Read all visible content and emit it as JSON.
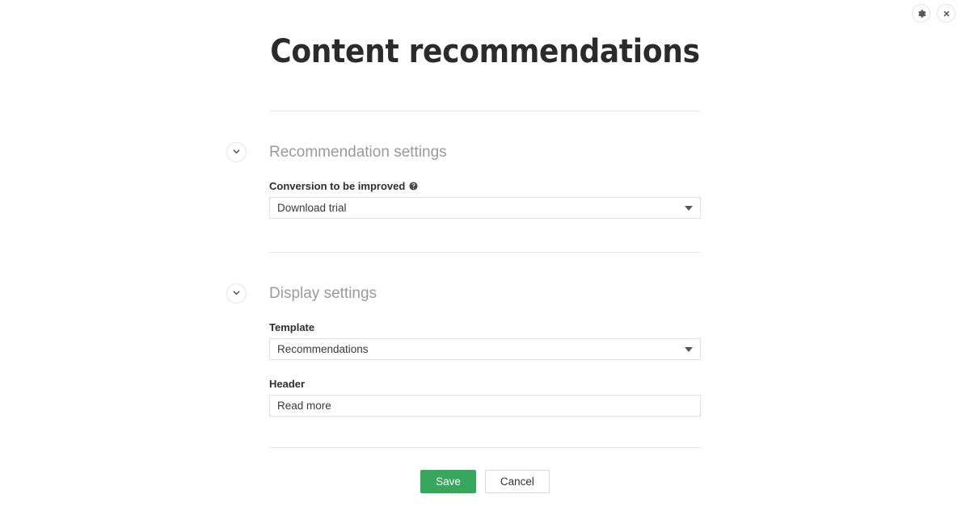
{
  "window": {
    "settings_label": "Settings",
    "settings_icon": "gear-icon",
    "close_label": "Close",
    "close_icon": "close-icon"
  },
  "page": {
    "title": "Content recommendations"
  },
  "sections": [
    {
      "id": "recommendation-settings",
      "title": "Recommendation settings",
      "toggle_icon": "chevron-down-icon",
      "fields": [
        {
          "id": "conversion-to-be-improved",
          "label": "Conversion to be improved",
          "help_icon": "help-icon",
          "has_help": true,
          "type": "select",
          "value": "Download trial",
          "caret_icon": "caret-down-icon"
        }
      ]
    },
    {
      "id": "display-settings",
      "title": "Display settings",
      "toggle_icon": "chevron-down-icon",
      "fields": [
        {
          "id": "template",
          "label": "Template",
          "has_help": false,
          "type": "select",
          "value": "Recommendations",
          "caret_icon": "caret-down-icon"
        },
        {
          "id": "header",
          "label": "Header",
          "has_help": false,
          "type": "text",
          "value": "Read more",
          "placeholder": ""
        }
      ]
    }
  ],
  "footer": {
    "save_label": "Save",
    "cancel_label": "Cancel"
  },
  "colors": {
    "save_green": "#36a75c",
    "section_title_gray": "#9a9a9a",
    "border_gray": "#e0e0e0",
    "divider_gray": "#e8e8e8",
    "title_dark": "#2b2b2b"
  }
}
